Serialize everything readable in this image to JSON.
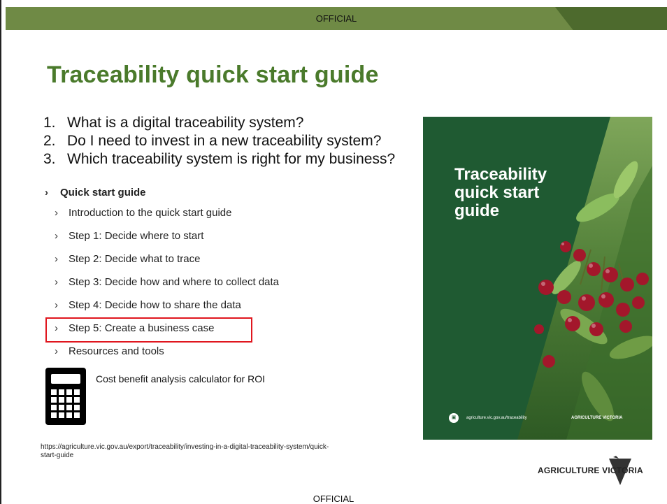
{
  "header": {
    "classification": "OFFICIAL"
  },
  "footer": {
    "classification": "OFFICIAL"
  },
  "slide": {
    "title": "Traceability quick start guide",
    "questions": [
      {
        "num": "1.",
        "text": "What is a digital traceability system?"
      },
      {
        "num": "2.",
        "text": "Do I need to invest in a new traceability system?"
      },
      {
        "num": "3.",
        "text": "Which traceability system is right for my business?"
      }
    ],
    "menu": {
      "heading": "Quick start guide",
      "items": [
        "Introduction to the quick start guide",
        "Step 1: Decide where to start",
        "Step 2: Decide what to trace",
        "Step 3: Decide how and where to collect data",
        "Step 4: Decide how to share the data",
        "Step 5: Create a business case",
        "Resources and tools"
      ],
      "highlighted_item": "Step 5: Create a business case",
      "highlight_color": "#e0161e"
    },
    "calculator": {
      "icon": "calculator-icon",
      "label": "Cost benefit analysis calculator for ROI"
    },
    "url": "https://agriculture.vic.gov.au/export/traceability/investing-in-a-digital-traceability-system/quick-start-guide",
    "cover": {
      "title_lines": [
        "Traceability",
        "quick start",
        "guide"
      ],
      "site": "agriculture.vic.gov.au/traceability",
      "brand": "AGRICULTURE VICTORIA"
    },
    "logo": {
      "text": "AGRICULTURE VICTORIA"
    }
  },
  "colors": {
    "accent_green": "#4a7a2b",
    "bar_green": "#6f8a45",
    "cover_green": "#1f5a32"
  }
}
